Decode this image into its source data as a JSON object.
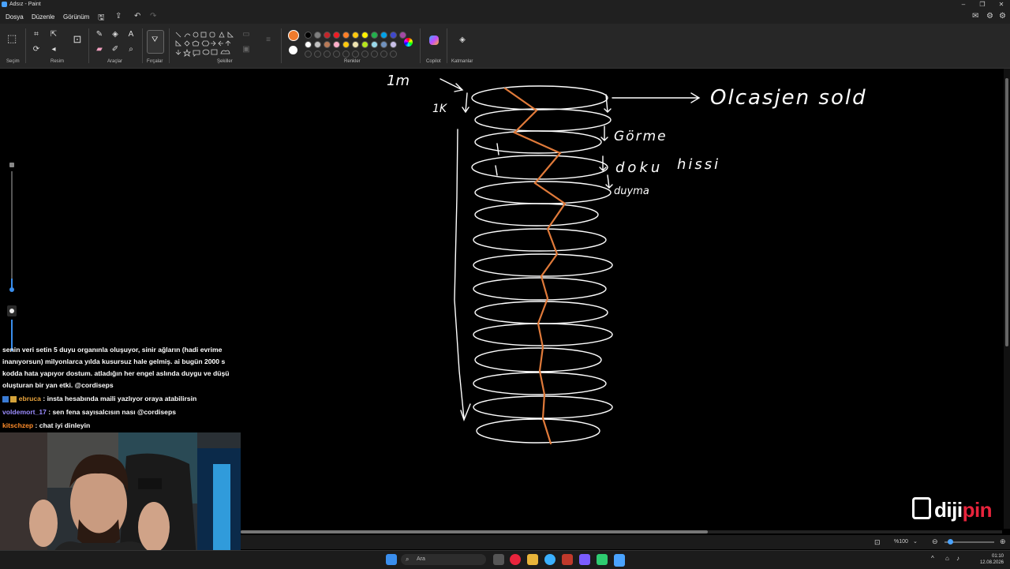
{
  "window": {
    "title": "Adsız - Paint"
  },
  "menu": {
    "file": "Dosya",
    "edit": "Düzenle",
    "view": "Görünüm"
  },
  "ribbon": {
    "groups": {
      "selection": "Seçim",
      "image": "Resim",
      "tools": "Araçlar",
      "brushes": "Fırçalar",
      "shapes": "Şekiller",
      "colors": "Renkler",
      "copilot": "Copilot",
      "layers": "Katmanlar"
    },
    "colors": {
      "primary": "#f07b2c",
      "secondary": "#ffffff",
      "palette_row1": [
        "#000000",
        "#7f7f7f",
        "#c3252a",
        "#ee1c24",
        "#ff7f27",
        "#ffc90e",
        "#fff200",
        "#22b14c",
        "#00a2e8",
        "#3f48cc",
        "#a349a4"
      ],
      "palette_row2": [
        "#ffffff",
        "#c3c3c3",
        "#b97a57",
        "#ffaec9",
        "#ffc90e",
        "#efe4b0",
        "#b5e61d",
        "#99d9ea",
        "#7092be",
        "#c8bfe7"
      ]
    }
  },
  "drawing": {
    "labels": {
      "top_left": "1m",
      "tick_left": "1K",
      "arrow_target": "Olcasjen sold",
      "label_2": "Görme",
      "label_3": "doku",
      "label_4": "hissi",
      "label_5": "duyma"
    },
    "stroke_color": "#ffffff",
    "accent_color": "#e07a3a"
  },
  "chat": {
    "messages": [
      {
        "user": "",
        "text": "senin veri setin 5 duyu organınla oluşuyor, sinir ağların (hadi evrime"
      },
      {
        "user": "",
        "text": "inanıyorsun) milyonlarca yılda kusursuz hale gelmiş. ai bugün 2000 s"
      },
      {
        "user": "",
        "text": "kodda hata yapıyor dostum. atladığın her engel aslında duygu ve düşü"
      },
      {
        "user": "",
        "text": "oluşturan bir yan etki. @cordiseps"
      },
      {
        "user": "ebruca",
        "text": " : insta hesabında maili yazlıyor oraya atabilirsin"
      },
      {
        "user": "voldemort_17",
        "text": " : sen fena sayısalcısın nası @cordiseps"
      },
      {
        "user": "kitschzep",
        "text": " : chat iyi dinleyin"
      }
    ],
    "user_colors": {
      "ebruca": "#e8a33c",
      "voldemort_17": "#9b8cff",
      "kitschzep": "#ff8c2a"
    },
    "mention_color": "#9aa0ff"
  },
  "statusbar": {
    "zoom": "%100"
  },
  "taskbar": {
    "search_placeholder": "Ara",
    "time": "01:10",
    "date": "12.08.2026"
  },
  "logo": {
    "text_white": "diji",
    "text_red": "pin"
  }
}
